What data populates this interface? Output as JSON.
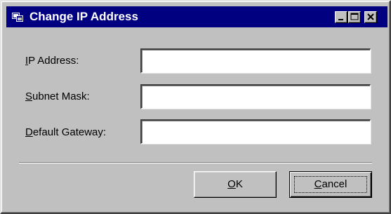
{
  "window": {
    "title": "Change IP Address"
  },
  "titlebar_buttons": {
    "minimize_icon": "minimize-icon",
    "maximize_icon": "maximize-icon",
    "close_icon": "close-icon"
  },
  "form": {
    "ip_label_mnemonic": "I",
    "ip_label_rest": "P Address:",
    "ip_value": "",
    "subnet_label_mnemonic": "S",
    "subnet_label_rest": "ubnet Mask:",
    "subnet_value": "",
    "gateway_label_mnemonic": "D",
    "gateway_label_rest": "efault Gateway:",
    "gateway_value": ""
  },
  "buttons": {
    "ok_mnemonic": "O",
    "ok_rest": "K",
    "cancel_mnemonic": "C",
    "cancel_rest": "ancel"
  },
  "colors": {
    "titlebar": "#000080",
    "face": "#c0c0c0",
    "field": "#ffffff"
  }
}
